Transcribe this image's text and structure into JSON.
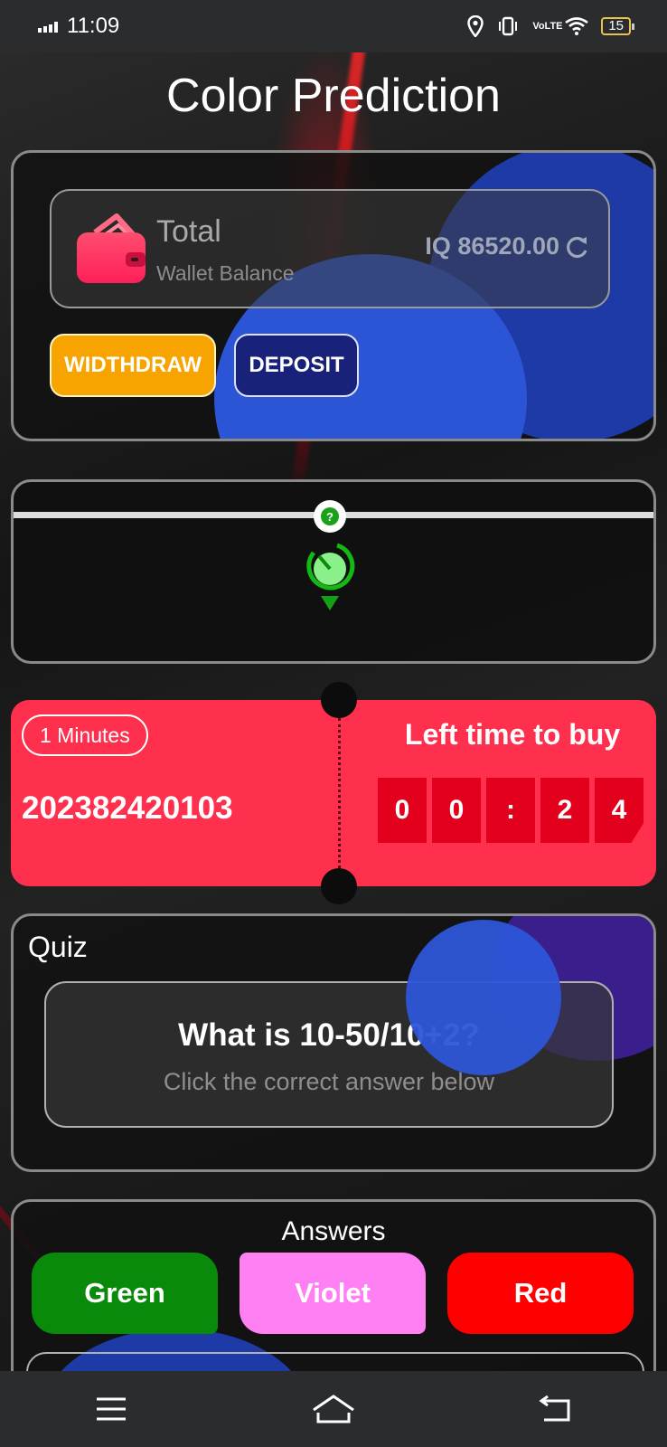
{
  "status_bar": {
    "time": "11:09",
    "network": "VoLTE",
    "battery": "15",
    "icons": [
      "signal-icon",
      "location-icon",
      "vibrate-icon",
      "volte-icon",
      "wifi-icon",
      "battery-icon"
    ]
  },
  "header": {
    "title": "Color Prediction"
  },
  "wallet": {
    "title": "Total",
    "subtitle": "Wallet Balance",
    "amount": "IQ 86520.00",
    "withdraw_label": "WIDTHDRAW",
    "deposit_label": "DEPOSIT",
    "colors": {
      "withdraw": "#f8a400",
      "deposit": "#18227a",
      "wallet_icon": "#ff2d55"
    }
  },
  "spinner": {
    "knob_symbol": "?",
    "accent": "#1aa01a"
  },
  "round": {
    "duration_label": "1 Minutes",
    "period_id": "202382420103",
    "left_time_label": "Left time to buy",
    "countdown": [
      "0",
      "0",
      ":",
      "2",
      "4"
    ],
    "color": "#ff304d"
  },
  "quiz": {
    "label": "Quiz",
    "question": "What is 10-50/10+2?",
    "hint": "Click the correct answer below"
  },
  "answers": {
    "title": "Answers",
    "options": [
      {
        "label": "Green",
        "color": "#0a8a0a"
      },
      {
        "label": "Violet",
        "color": "#ff80f2"
      },
      {
        "label": "Red",
        "color": "#ff0000"
      }
    ]
  },
  "nav": {
    "icons": [
      "menu-icon",
      "home-icon",
      "back-icon"
    ]
  }
}
